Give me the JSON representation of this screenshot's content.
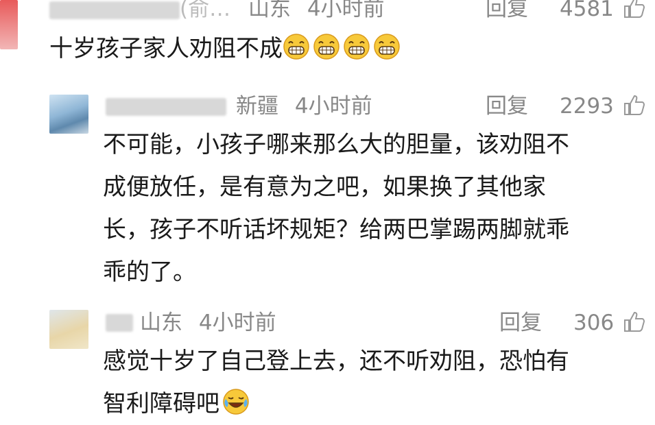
{
  "comments": [
    {
      "location": "山东",
      "time": "4小时前",
      "name_tail": "(俞…",
      "reply_label": "回复",
      "likes": "4581",
      "text": "十岁孩子家人劝阻不成",
      "emoji": "grin-emoji"
    },
    {
      "location": "新疆",
      "time": "4小时前",
      "reply_label": "回复",
      "likes": "2293",
      "lines": [
        "不可能，小孩子哪来那么大的胆量，该劝阻不",
        "成便放任，是有意为之吧，如果换了其他家",
        "长，孩子不听话坏规矩？给两巴掌踢两脚就乖",
        "乖的了。"
      ]
    },
    {
      "location": "山东",
      "time": "4小时前",
      "reply_label": "回复",
      "likes": "306",
      "lines": [
        "感觉十岁了自己登上去，还不听劝阻，恐怕有",
        "智利障碍吧"
      ],
      "emoji": "laugh-cry-emoji"
    }
  ],
  "colors": {
    "meta_gray": "#888888",
    "text": "#1a1a1a",
    "emoji_yellow": "#f7c93a"
  }
}
